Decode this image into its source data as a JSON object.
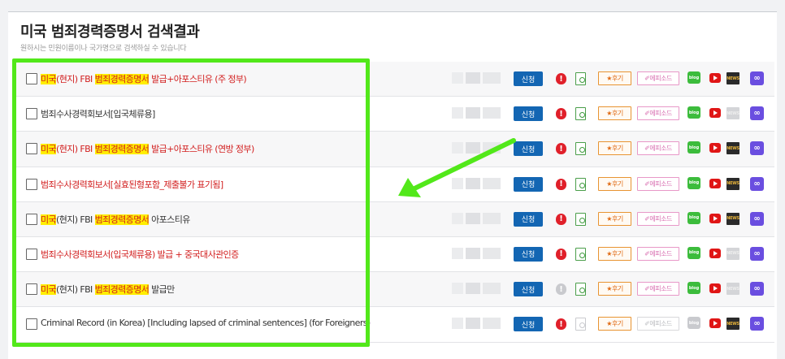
{
  "page": {
    "title": "미국 범죄경력증명서 검색결과",
    "subtitle": "원하시는 민원이름이나 국가명으로 검색하실 수 있습니다"
  },
  "labels": {
    "apply": "신청",
    "review": "★후기",
    "episode": "✐에피소드",
    "blog": "blog",
    "news": "NEWS",
    "alert": "!",
    "link": "∞"
  },
  "rows": [
    {
      "segments": [
        {
          "text": "미국",
          "style": "hl-red"
        },
        {
          "text": "(현지) FBI ",
          "style": "red"
        },
        {
          "text": "범죄경력증명서",
          "style": "hl-red"
        },
        {
          "text": " 발급+아포스티유 (주 정부)",
          "style": "red"
        }
      ],
      "muted": false
    },
    {
      "segments": [
        {
          "text": "범죄수사경력회보서[입국체류용]",
          "style": "plain"
        }
      ],
      "muted": false
    },
    {
      "segments": [
        {
          "text": "미국",
          "style": "hl-red"
        },
        {
          "text": "(현지) FBI ",
          "style": "red"
        },
        {
          "text": "범죄경력증명서",
          "style": "hl-red"
        },
        {
          "text": " 발급+아포스티유 (연방 정부)",
          "style": "red"
        }
      ],
      "muted": false
    },
    {
      "segments": [
        {
          "text": "범죄수사경력회보서[실효된형포함_제출불가 표기됨]",
          "style": "red"
        }
      ],
      "muted": false
    },
    {
      "segments": [
        {
          "text": "미국",
          "style": "hl-red"
        },
        {
          "text": "(현지) FBI ",
          "style": "plain"
        },
        {
          "text": "범죄경력증명서",
          "style": "hl-red"
        },
        {
          "text": " 아포스티유",
          "style": "plain"
        }
      ],
      "muted": false
    },
    {
      "segments": [
        {
          "text": "범죄수사경력회보서(입국체류용) 발급 + 중국대사관인증",
          "style": "red"
        }
      ],
      "muted": false
    },
    {
      "segments": [
        {
          "text": "미국",
          "style": "hl-red"
        },
        {
          "text": "(현지) FBI ",
          "style": "plain"
        },
        {
          "text": "범죄경력증명서",
          "style": "hl-red"
        },
        {
          "text": " 발급만",
          "style": "plain"
        }
      ],
      "muted": false
    },
    {
      "segments": [
        {
          "text": "Criminal Record (in Korea) [Including lapsed of criminal sentences] (for Foreigners)",
          "style": "plain"
        }
      ],
      "muted": true
    }
  ],
  "colors": {
    "accent_blue": "#1366b3",
    "highlight_green": "#52e81a",
    "alert_red": "#e0202a",
    "text_red": "#d21e1e",
    "highlight_yellow": "#ffee00"
  }
}
